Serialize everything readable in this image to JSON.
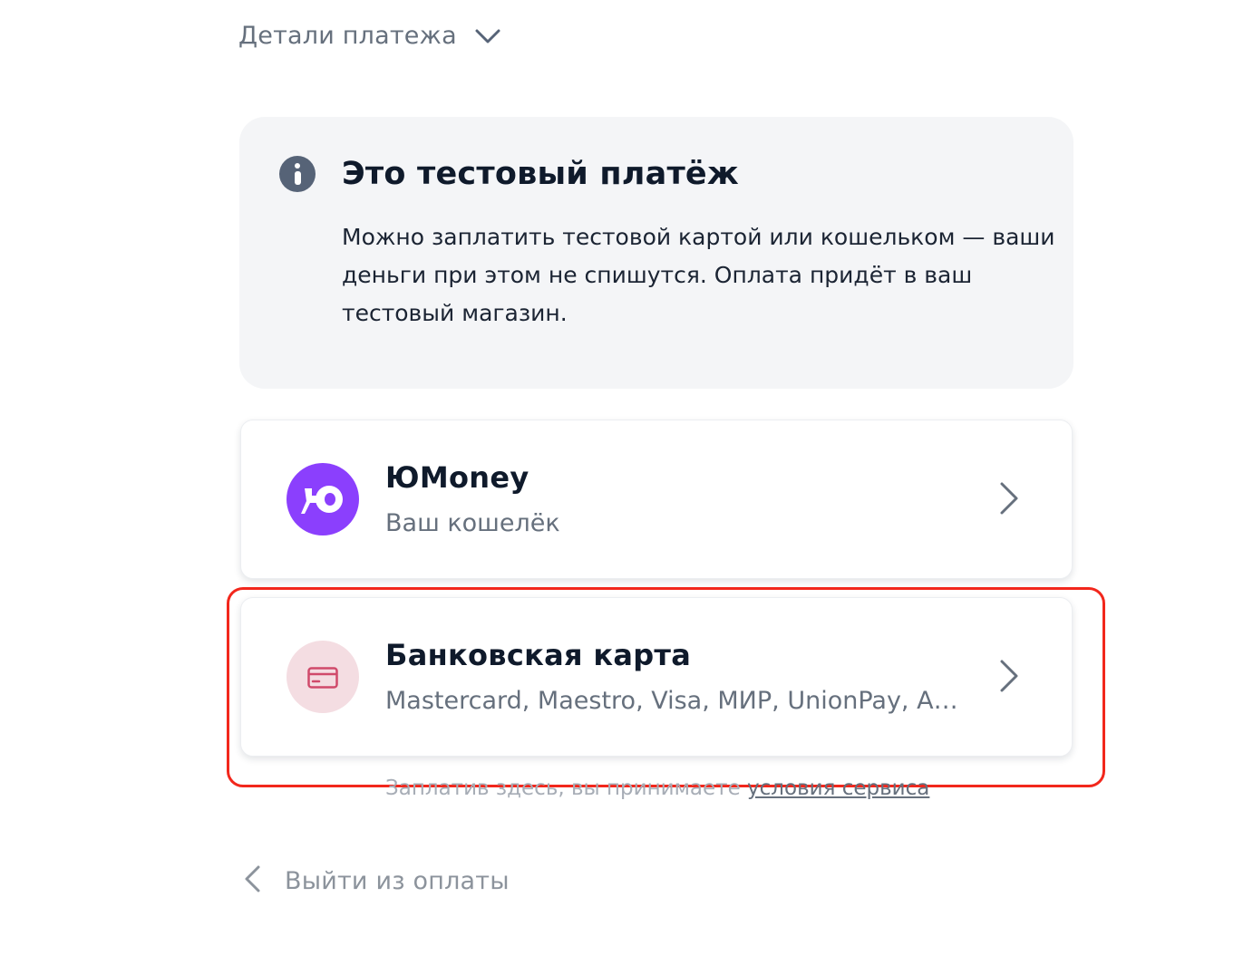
{
  "details": {
    "label": "Детали платежа",
    "icon": "chevron-down-icon"
  },
  "notice": {
    "icon": "info-icon",
    "title": "Это тестовый платёж",
    "text": "Можно заплатить тестовой картой или кошельком — ваши деньги при этом не спишутся. Оплата придёт в ваш тестовый магазин."
  },
  "methods": [
    {
      "title": "ЮMoney",
      "subtitle": "Ваш кошелёк",
      "icon": "yoomoney-logo",
      "color": "#8b3ffd"
    },
    {
      "title": "Банковская карта",
      "subtitle": "Mastercard, Maestro, Visa, МИР, UnionPay, American Express",
      "icon": "credit-card-icon",
      "color": "#f4dde2"
    }
  ],
  "terms": {
    "prefix": "Заплатив здесь, вы принимаете",
    "link": "условия сервиса"
  },
  "exit": {
    "label": "Выйти из оплаты",
    "icon": "chevron-left-icon"
  },
  "colors": {
    "accent_purple": "#8b3ffd",
    "highlight": "#f2271c",
    "notice_bg": "#f4f5f7"
  }
}
